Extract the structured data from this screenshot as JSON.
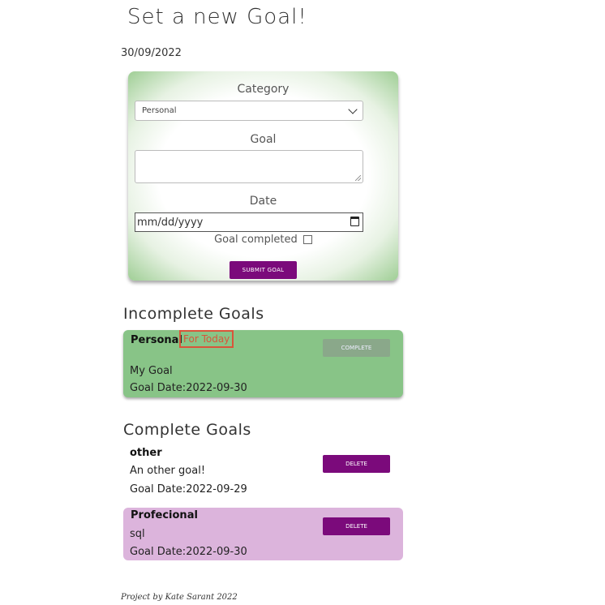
{
  "header": {
    "title": "Set a new Goal!",
    "current_date": "30/09/2022"
  },
  "form": {
    "category_label": "Category",
    "category_value": "Personal",
    "goal_label": "Goal",
    "goal_value": "",
    "date_label": "Date",
    "date_placeholder": "mm/dd/yyyy",
    "completed_label": "Goal completed",
    "completed_checked": false,
    "submit_label": "SUBMIT GOAL"
  },
  "incomplete": {
    "heading": "Incomplete Goals",
    "goals": [
      {
        "category": "Personal",
        "tag": "For Today",
        "description": "My Goal",
        "date_text": "Goal Date:2022-09-30",
        "action_label": "COMPLETE"
      }
    ]
  },
  "complete": {
    "heading": "Complete Goals",
    "goals": [
      {
        "category": "other",
        "description": "An other goal!",
        "date_text": "Goal Date:2022-09-29",
        "action_label": "DELETE"
      },
      {
        "category": "Profecional",
        "description": "sql",
        "date_text": "Goal Date:2022-09-30",
        "action_label": "DELETE"
      }
    ]
  },
  "footer": {
    "text": "Project by Kate Sarant 2022"
  },
  "colors": {
    "green_card": "#88c487",
    "pink_card": "#dcb4dc",
    "purple_button": "#7b0a7b",
    "today_tag": "#d9553a"
  }
}
